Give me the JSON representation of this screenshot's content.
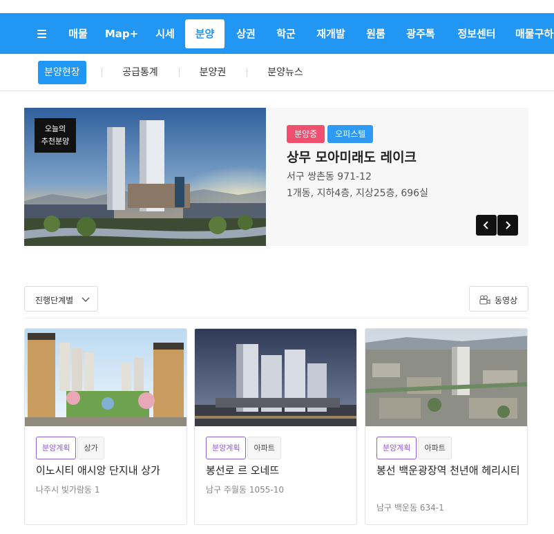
{
  "nav": {
    "items": [
      "매물",
      "Map+",
      "시세",
      "분양",
      "상권",
      "학군",
      "재개발",
      "원룸",
      "광주톡",
      "정보센터",
      "매물구하"
    ],
    "active": "분양"
  },
  "subnav": {
    "items": [
      "분양현장",
      "공급통계",
      "분양권",
      "분양뉴스"
    ]
  },
  "hero": {
    "tag_line1": "오늘의",
    "tag_line2": "추천분양",
    "badge_status": "분양중",
    "badge_type": "오피스텔",
    "title": "상무 모아미래도 레이크",
    "address": "서구 쌍촌동 971-12",
    "info": "1개동, 지하4층, 지상25층, 696실"
  },
  "filters": {
    "stage_label": "진행단계별",
    "video_label": "동영상"
  },
  "cards": [
    {
      "status": "분양계획",
      "type": "상가",
      "title": "이노시티 애시앙 단지내 상가",
      "address": "나주시 빛가람동 1"
    },
    {
      "status": "분양계획",
      "type": "아파트",
      "title": "봉선로 르 오네뜨",
      "address": "남구 주월동 1055-10"
    },
    {
      "status": "분양계획",
      "type": "아파트",
      "title": "봉선 백운광장역 천년애 헤리시티",
      "address": "남구 백운동 634-1"
    }
  ],
  "colors": {
    "primary": "#2196f3",
    "badge_red": "#f0506e",
    "tag_purple": "#8e5fd6"
  },
  "icons": [
    "menu-icon",
    "chevron-down-icon",
    "video-camera-icon",
    "arrow-left-icon",
    "arrow-right-icon"
  ]
}
